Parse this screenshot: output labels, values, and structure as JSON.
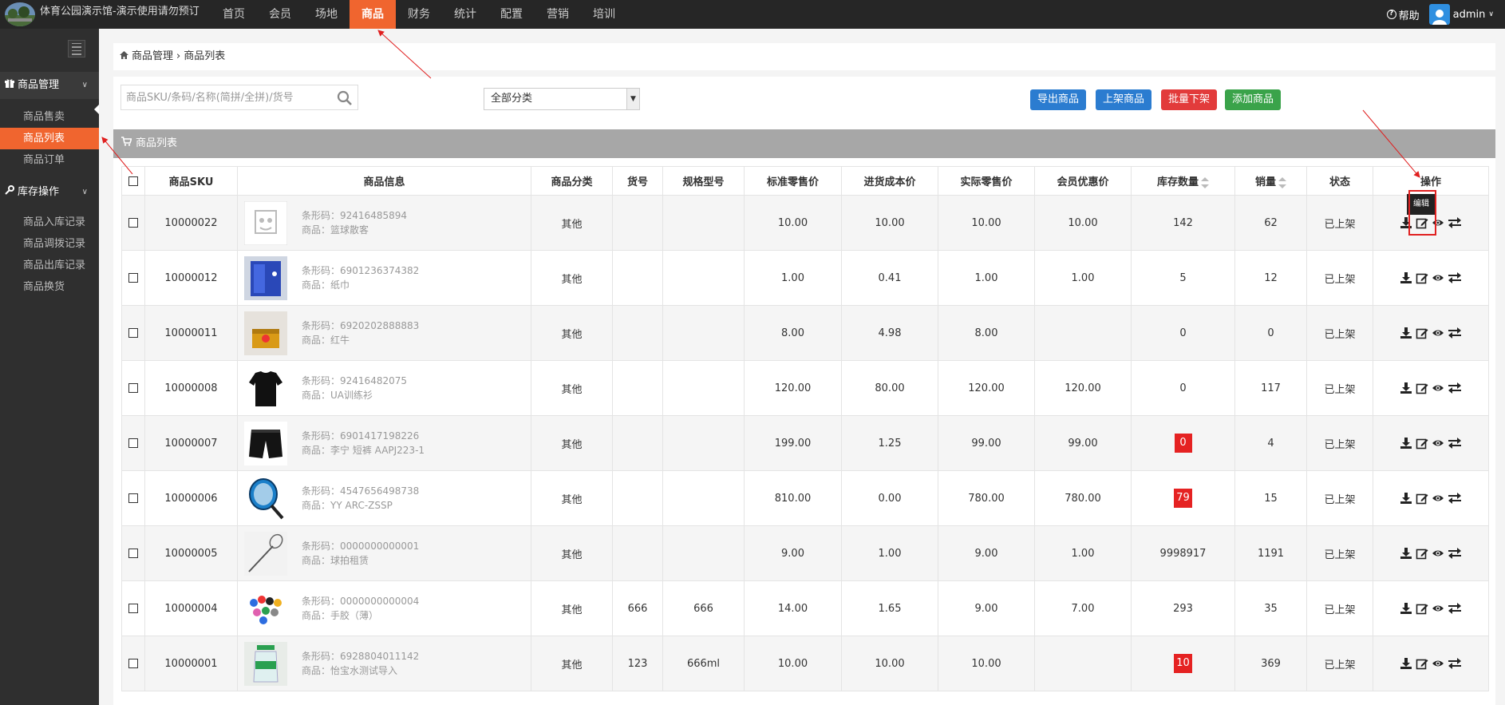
{
  "app": {
    "title": "体育公园演示馆-演示使用请勿预订",
    "help": "帮助",
    "user": "admin"
  },
  "nav": [
    "首页",
    "会员",
    "场地",
    "商品",
    "财务",
    "统计",
    "配置",
    "营销",
    "培训"
  ],
  "nav_active": "商品",
  "sidebar": {
    "group1": "商品管理",
    "group1_items": [
      "商品售卖",
      "商品列表",
      "商品订单"
    ],
    "group2": "库存操作",
    "group2_items": [
      "商品入库记录",
      "商品调拨记录",
      "商品出库记录",
      "商品换货"
    ],
    "active": "商品列表"
  },
  "breadcrumb": {
    "root": "商品管理",
    "sep": "›",
    "current": "商品列表"
  },
  "toolbar": {
    "search_placeholder": "商品SKU/条码/名称(简拼/全拼)/货号",
    "category": "全部分类",
    "export": "导出商品",
    "shelf": "上架商品",
    "batch_off": "批量下架",
    "add": "添加商品"
  },
  "panel": {
    "title": "商品列表",
    "tooltip": "编辑"
  },
  "table": {
    "headers": [
      "",
      "商品SKU",
      "商品信息",
      "商品分类",
      "货号",
      "规格型号",
      "标准零售价",
      "进货成本价",
      "实际零售价",
      "会员优惠价",
      "库存数量",
      "销量",
      "状态",
      "操作"
    ],
    "barcode_label": "条形码：",
    "name_label": "商品：",
    "rows": [
      {
        "sku": "10000022",
        "barcode": "92416485894",
        "name": "篮球散客",
        "category": "其他",
        "item_no": "",
        "spec": "",
        "retail": "10.00",
        "cost": "10.00",
        "actual": "10.00",
        "member": "10.00",
        "stock": "142",
        "stock_alert": false,
        "sales": "62",
        "status": "已上架"
      },
      {
        "sku": "10000012",
        "barcode": "6901236374382",
        "name": "纸巾",
        "category": "其他",
        "item_no": "",
        "spec": "",
        "retail": "1.00",
        "cost": "0.41",
        "actual": "1.00",
        "member": "1.00",
        "stock": "5",
        "stock_alert": false,
        "sales": "12",
        "status": "已上架"
      },
      {
        "sku": "10000011",
        "barcode": "6920202888883",
        "name": "红牛",
        "category": "其他",
        "item_no": "",
        "spec": "",
        "retail": "8.00",
        "cost": "4.98",
        "actual": "8.00",
        "member": "",
        "stock": "0",
        "stock_alert": false,
        "sales": "0",
        "status": "已上架"
      },
      {
        "sku": "10000008",
        "barcode": "92416482075",
        "name": "UA训练衫",
        "category": "其他",
        "item_no": "",
        "spec": "",
        "retail": "120.00",
        "cost": "80.00",
        "actual": "120.00",
        "member": "120.00",
        "stock": "0",
        "stock_alert": false,
        "sales": "117",
        "status": "已上架"
      },
      {
        "sku": "10000007",
        "barcode": "6901417198226",
        "name": "李宁 短裤 AAPJ223-1",
        "category": "其他",
        "item_no": "",
        "spec": "",
        "retail": "199.00",
        "cost": "1.25",
        "actual": "99.00",
        "member": "99.00",
        "stock": "0",
        "stock_alert": true,
        "sales": "4",
        "status": "已上架"
      },
      {
        "sku": "10000006",
        "barcode": "4547656498738",
        "name": "YY ARC-ZSSP",
        "category": "其他",
        "item_no": "",
        "spec": "",
        "retail": "810.00",
        "cost": "0.00",
        "actual": "780.00",
        "member": "780.00",
        "stock": "79",
        "stock_alert": true,
        "sales": "15",
        "status": "已上架"
      },
      {
        "sku": "10000005",
        "barcode": "0000000000001",
        "name": "球拍租赁",
        "category": "其他",
        "item_no": "",
        "spec": "",
        "retail": "9.00",
        "cost": "1.00",
        "actual": "9.00",
        "member": "1.00",
        "stock": "9998917",
        "stock_alert": false,
        "sales": "1191",
        "status": "已上架"
      },
      {
        "sku": "10000004",
        "barcode": "0000000000004",
        "name": "手胶（薄）",
        "category": "其他",
        "item_no": "666",
        "spec": "666",
        "retail": "14.00",
        "cost": "1.65",
        "actual": "9.00",
        "member": "7.00",
        "stock": "293",
        "stock_alert": false,
        "sales": "35",
        "status": "已上架"
      },
      {
        "sku": "10000001",
        "barcode": "6928804011142",
        "name": "怡宝水测试导入",
        "category": "其他",
        "item_no": "123",
        "spec": "666ml",
        "retail": "10.00",
        "cost": "10.00",
        "actual": "10.00",
        "member": "",
        "stock": "10",
        "stock_alert": true,
        "sales": "369",
        "status": "已上架"
      }
    ]
  },
  "colors": {
    "topbar": "#262626",
    "accent": "#f0652f",
    "sidebar": "#2f2f2f",
    "blue_button": "#2b7cd0",
    "red_button": "#e23b3b",
    "green_button": "#3aa34a",
    "stock_alert": "#e52222",
    "annotation": "#e02020"
  }
}
